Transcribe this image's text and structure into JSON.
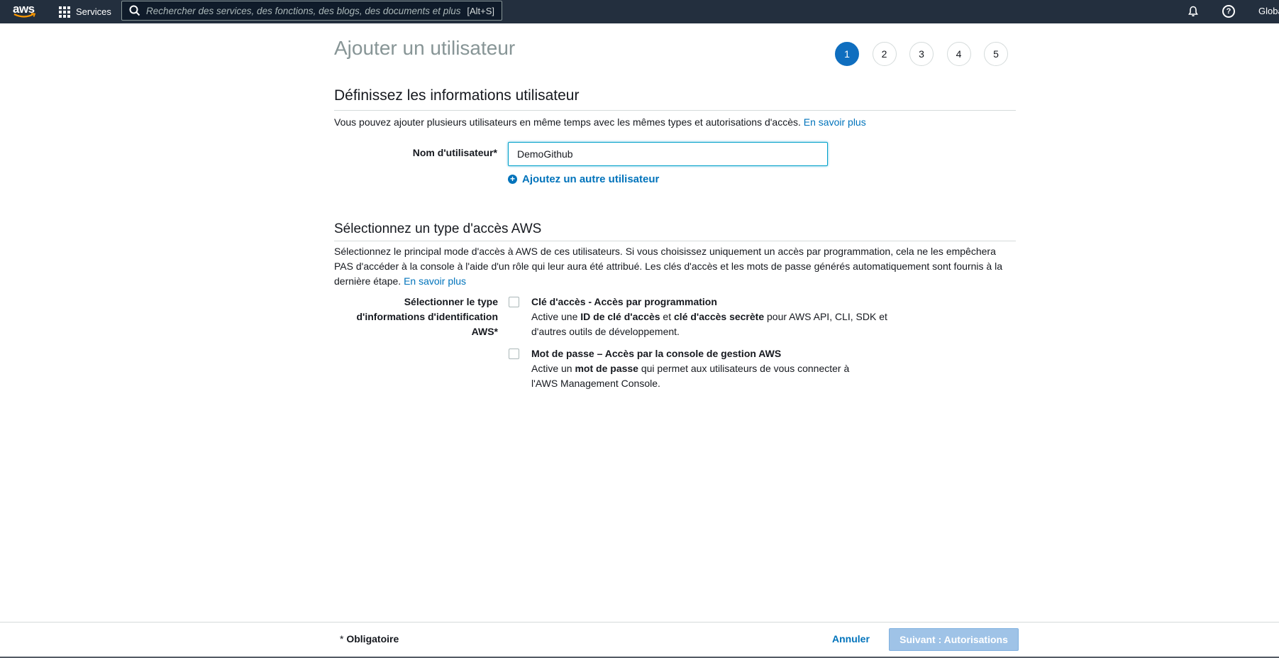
{
  "topnav": {
    "logo_text": "aws",
    "services_label": "Services",
    "search_placeholder": "Rechercher des services, des fonctions, des blogs, des documents et plus",
    "search_shortcut": "[Alt+S]",
    "region_label": "Global"
  },
  "page": {
    "title": "Ajouter un utilisateur",
    "steps": [
      "1",
      "2",
      "3",
      "4",
      "5"
    ],
    "active_step": "1"
  },
  "user_info": {
    "section_title": "Définissez les informations utilisateur",
    "description": "Vous pouvez ajouter plusieurs utilisateurs en même temps avec les mêmes types et autorisations d'accès.",
    "learn_more": "En savoir plus",
    "username_label": "Nom d'utilisateur*",
    "username_value": "DemoGithub",
    "add_user_link": "Ajoutez un autre utilisateur"
  },
  "access_type": {
    "section_title": "Sélectionnez un type d'accès AWS",
    "description": "Sélectionnez le principal mode d'accès à AWS de ces utilisateurs. Si vous choisissez uniquement un accès par programmation, cela ne les empêchera PAS d'accéder à la console à l'aide d'un rôle qui leur aura été attribué. Les clés d'accès et les mots de passe générés automatiquement sont fournis à la dernière étape.",
    "learn_more": "En savoir plus",
    "select_label_line1": "Sélectionner le type",
    "select_label_line2": "d'informations d'identification",
    "select_label_line3": "AWS*",
    "options": [
      {
        "title": "Clé d'accès - Accès par programmation",
        "desc_prefix": "Active une ",
        "desc_bold1": "ID de clé d'accès",
        "desc_mid": " et ",
        "desc_bold2": "clé d'accès secrète",
        "desc_suffix": " pour AWS API, CLI, SDK et d'autres outils de développement.",
        "checked": false
      },
      {
        "title": "Mot de passe – Accès par la console de gestion AWS",
        "desc_prefix": "Active un ",
        "desc_bold1": "mot de passe",
        "desc_suffix": " qui permet aux utilisateurs de vous connecter à l'AWS Management Console.",
        "checked": false
      }
    ]
  },
  "footer": {
    "required_star": "*",
    "required_note": "Obligatoire",
    "cancel_label": "Annuler",
    "next_label": "Suivant : Autorisations"
  },
  "colors": {
    "nav_bg": "#232f3e",
    "accent": "#0073bb",
    "step_active": "#0f6ebf",
    "next_disabled": "#9fc3e7"
  }
}
